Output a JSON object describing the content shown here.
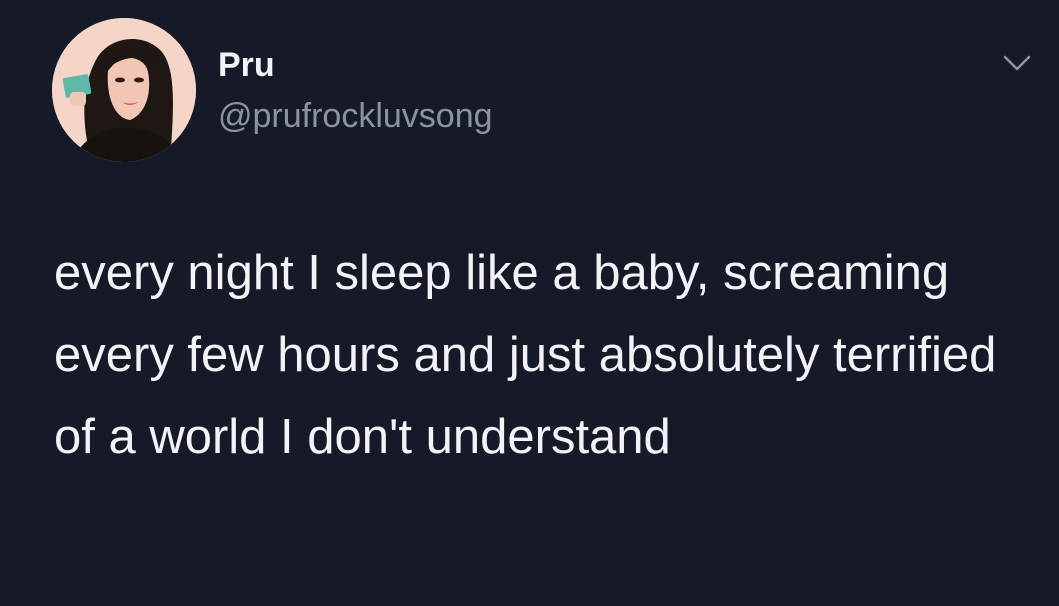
{
  "tweet": {
    "author": {
      "display_name": "Pru",
      "handle": "@prufrockluvsong"
    },
    "text": "every night I sleep like a baby, screaming every few hours and just absolutely terrified of a world I don't understand"
  },
  "icons": {
    "menu": "chevron-down-icon"
  },
  "colors": {
    "background": "#161a28",
    "text_primary": "#f2f3f6",
    "text_secondary": "#8b93a1"
  }
}
